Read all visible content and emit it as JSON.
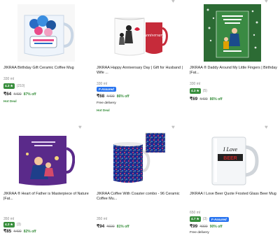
{
  "products": [
    {
      "title": "JIKRAA Birthday Gift Ceramic Coffee Mug",
      "size": "330 ml",
      "rating": "4.3 ★",
      "count": "(210)",
      "price": "₹64",
      "mrp": "₹499",
      "off": "87% off",
      "hot": "Hot Deal",
      "image": "birthday-mug"
    },
    {
      "title": "JIKRAA Happy Anniversary Day | Gift for Husband | Wife ...",
      "size": "330 ml",
      "assured": "F-Assured",
      "price": "₹68",
      "mrp": "₹499",
      "off": "86% off",
      "delivery": "Free delivery",
      "hot": "Hot Deal",
      "image": "anniversary-mug"
    },
    {
      "title": "JIKRAA ® Daddy Around My Little Fingers | Birthday |Fat...",
      "size": "330 ml",
      "rating": "4.3 ★",
      "count": "(5)",
      "price": "₹69",
      "mrp": "₹499",
      "off": "86% off",
      "image": "daddy-mug"
    },
    {
      "title": "JIKRAA ® Heart of Father is Masterpiece of Nature |Fat...",
      "size": "350 ml",
      "rating": "4.3 ★",
      "count": "(3)",
      "price": "₹85",
      "mrp": "₹499",
      "off": "82% off",
      "image": "father-mug"
    },
    {
      "title": "JIKRAA Coffee With Coaster combo - 96 Ceramic Coffee Mu...",
      "size": "350 ml",
      "price": "₹94",
      "mrp": "₹699",
      "off": "81% off",
      "image": "coaster-mug"
    },
    {
      "title": "JIKRAA I Love Beer Quote Frosted Glass Beer Mug",
      "size": "650 ml",
      "rating": "4.7 ★",
      "count": "(3)",
      "assured": "F-Assured",
      "price": "₹99",
      "mrp": "₹999",
      "off": "90% off",
      "delivery": "Free delivery",
      "image": "beer-mug"
    }
  ],
  "image_text": {
    "anniversary": "Anniversary",
    "beer_line1": "I Love",
    "beer_line2": "BEER"
  },
  "colors": {
    "green": "#388e3c",
    "blue": "#2874f0",
    "grey": "#878787"
  }
}
